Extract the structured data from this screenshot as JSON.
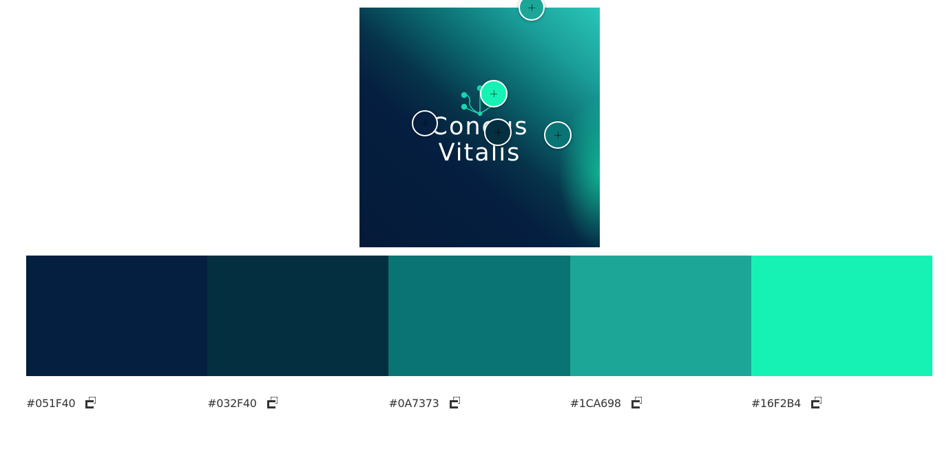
{
  "image": {
    "logo_text": "Coneus\nVitalis"
  },
  "pickers": [
    {
      "color": "#1CA698",
      "icon": "plus-crosshair-icon"
    },
    {
      "color": "#16F2B4",
      "icon": "plus-crosshair-icon"
    },
    {
      "color": "#051F40",
      "icon": "plus-crosshair-icon"
    },
    {
      "color": "#032F40",
      "icon": "plus-crosshair-icon"
    },
    {
      "color": "#0A7373",
      "icon": "plus-crosshair-icon"
    }
  ],
  "palette": [
    {
      "hex": "#051F40",
      "color": "#051F40",
      "copy_icon": "copy-icon"
    },
    {
      "hex": "#032F40",
      "color": "#032F40",
      "copy_icon": "copy-icon"
    },
    {
      "hex": "#0A7373",
      "color": "#0A7373",
      "copy_icon": "copy-icon"
    },
    {
      "hex": "#1CA698",
      "color": "#1CA698",
      "copy_icon": "copy-icon"
    },
    {
      "hex": "#16F2B4",
      "color": "#16F2B4",
      "copy_icon": "copy-icon"
    }
  ]
}
